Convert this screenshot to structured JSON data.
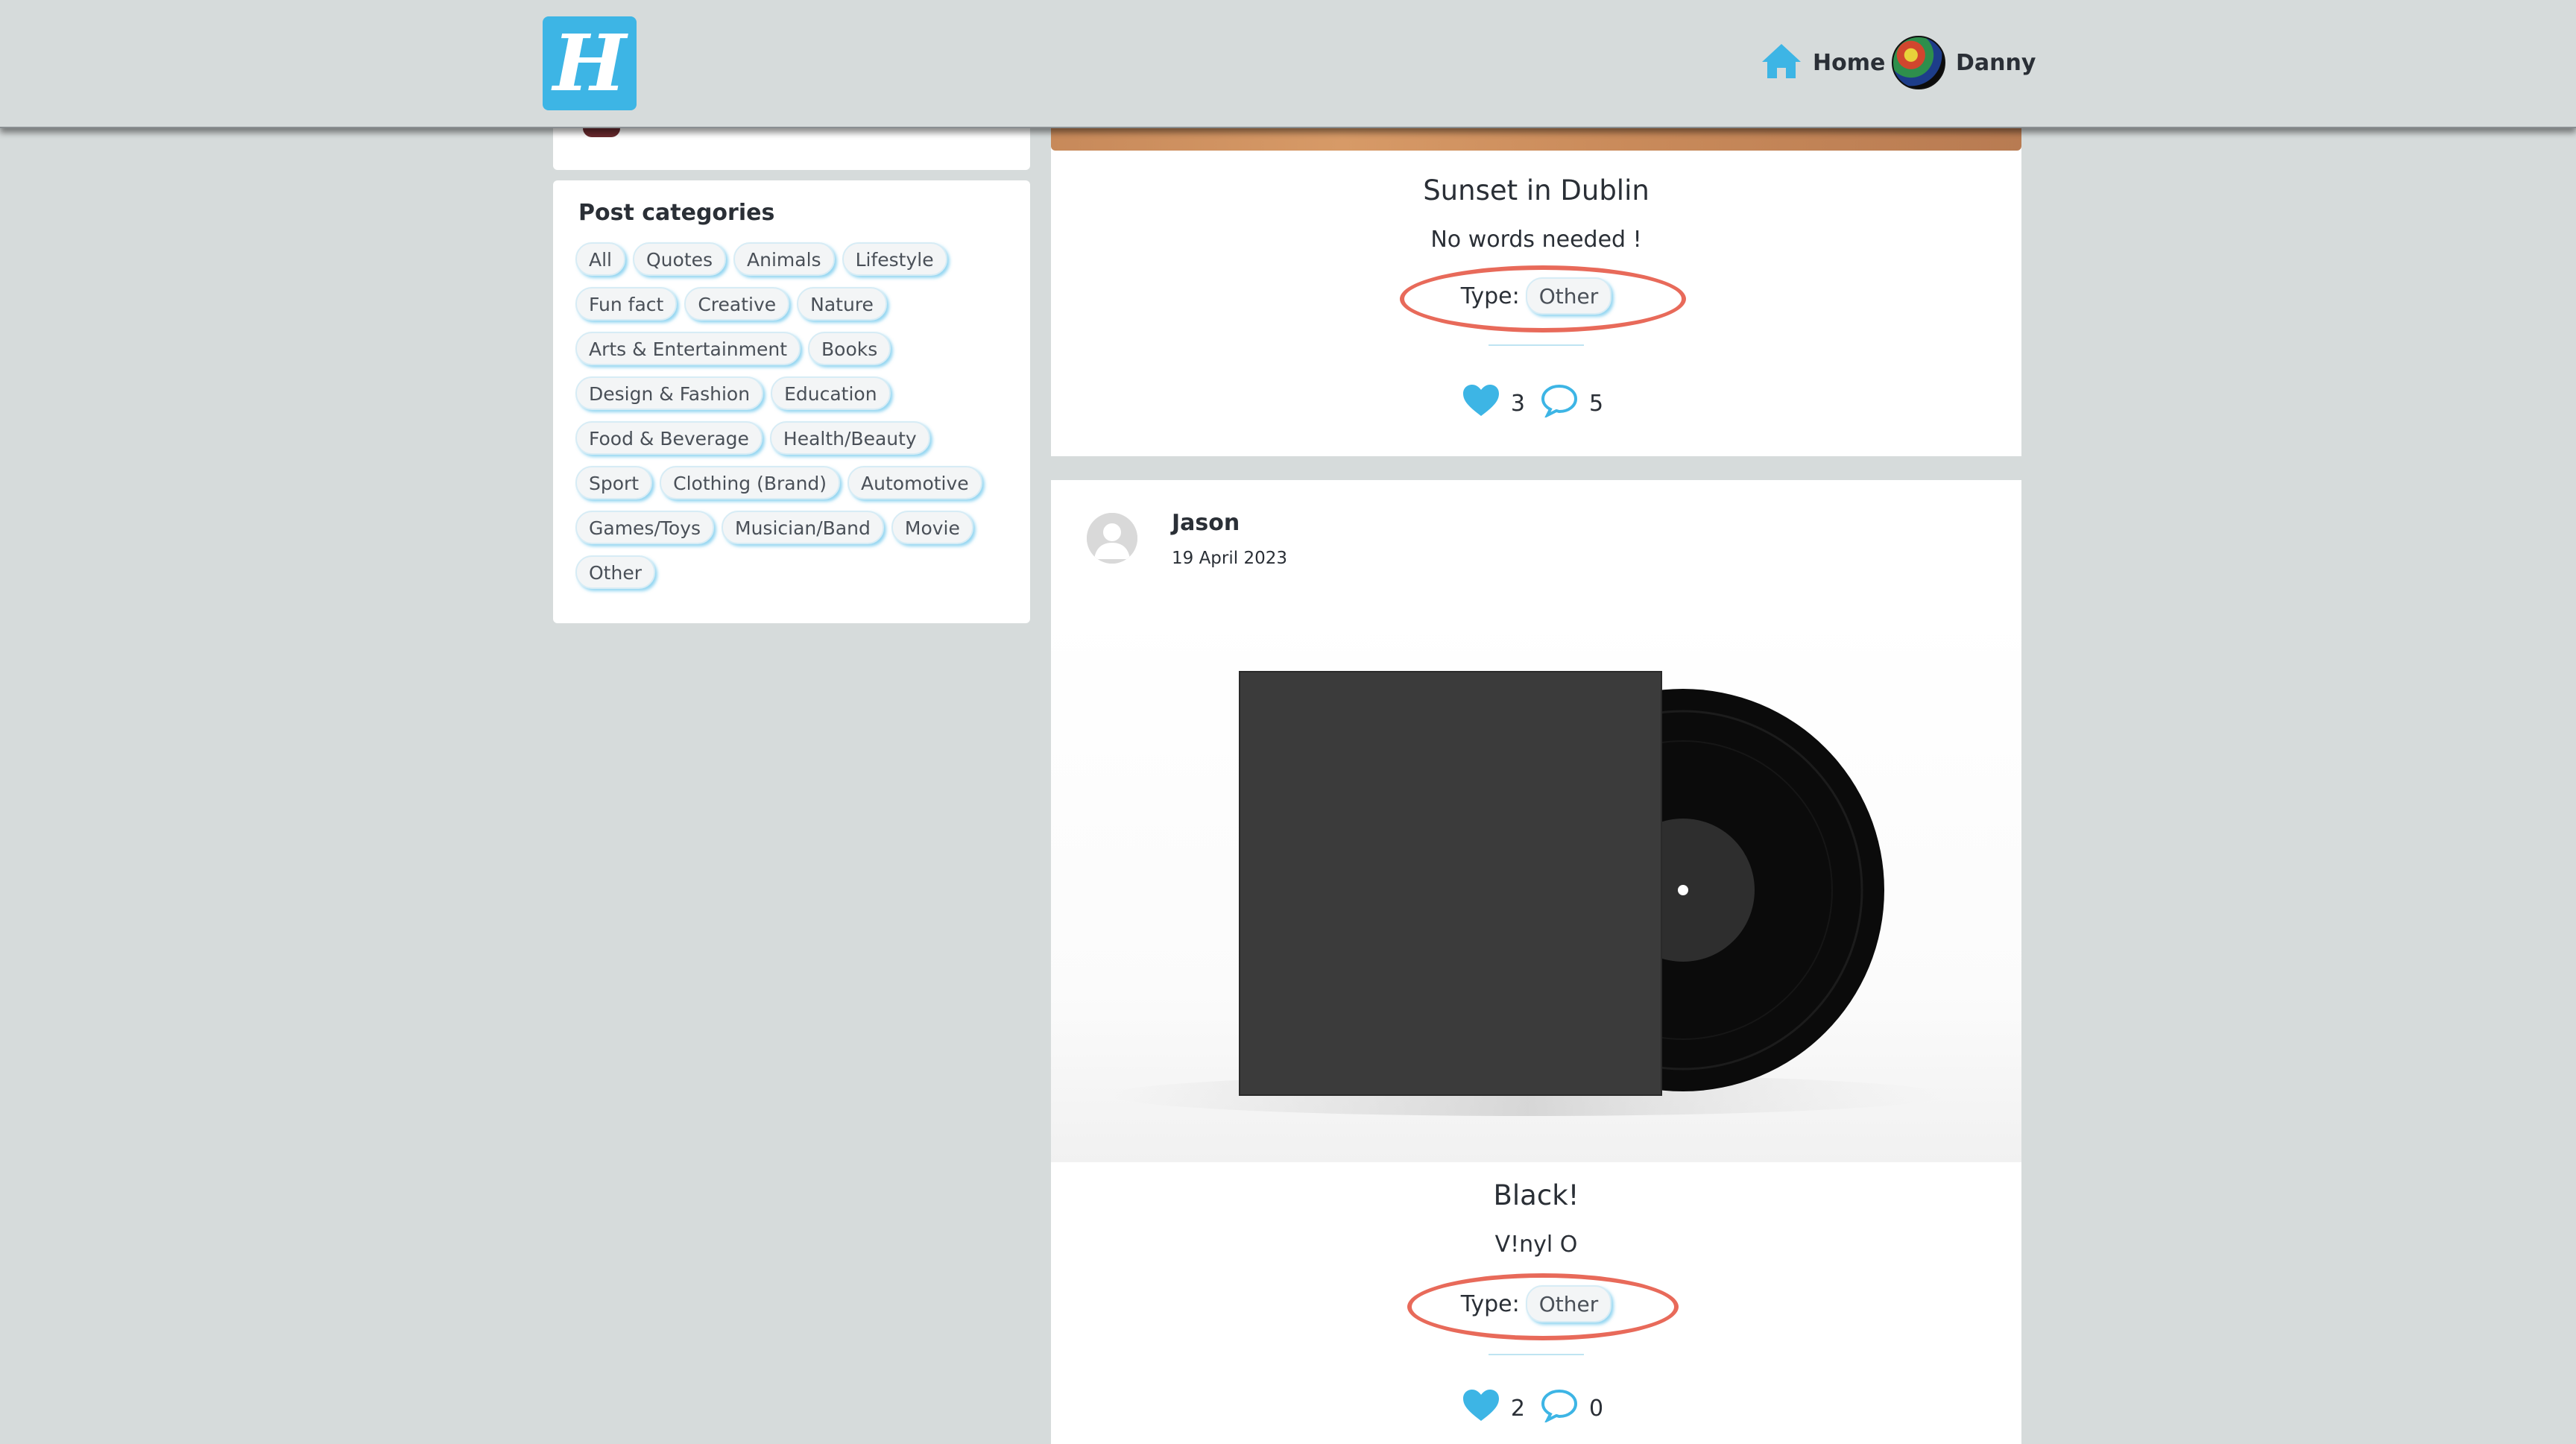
{
  "header": {
    "logo_letter": "H",
    "home_label": "Home",
    "user_name": "Danny"
  },
  "sidebar": {
    "categories_title": "Post categories",
    "categories": [
      "All",
      "Quotes",
      "Animals",
      "Lifestyle",
      "Fun fact",
      "Creative",
      "Nature",
      "Arts & Entertainment",
      "Books",
      "Design & Fashion",
      "Education",
      "Food & Beverage",
      "Health/Beauty",
      "Sport",
      "Clothing (Brand)",
      "Automotive",
      "Games/Toys",
      "Musician/Band",
      "Movie",
      "Other"
    ]
  },
  "posts": [
    {
      "title": "Sunset in Dublin",
      "text": "No words needed !",
      "type_label": "Type:",
      "type_value": "Other",
      "likes": "3",
      "comments": "5"
    },
    {
      "author": "Jason",
      "date": "19 April 2023",
      "title": "Black!",
      "text": "V!nyl O",
      "type_label": "Type:",
      "type_value": "Other",
      "likes": "2",
      "comments": "0"
    }
  ],
  "colors": {
    "accent": "#3db5e5",
    "background": "#d6dbdb",
    "highlight_oval": "#e86a5a"
  },
  "icons": {
    "home": "home-icon",
    "like": "heart-icon",
    "comment": "comment-icon"
  }
}
